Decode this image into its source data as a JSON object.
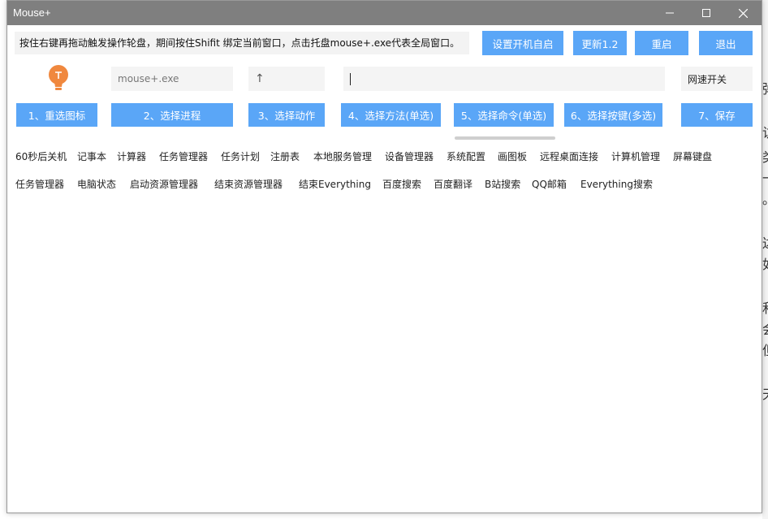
{
  "window": {
    "title": "Mouse+"
  },
  "hint": "按住右键再拖动触发操作轮盘，期间按住Shifit 绑定当前窗口，点击托盘mouse+.exe代表全局窗口。",
  "top_buttons": {
    "autostart": "设置开机自启",
    "update": "更新1.2",
    "restart": "重启",
    "exit": "退出"
  },
  "fields": {
    "process_placeholder": "mouse+.exe",
    "action_value": "↑",
    "command_value": "",
    "speed_toggle": "网速开关"
  },
  "steps": [
    "1、重选图标",
    "2、选择进程",
    "3、选择动作",
    "4、选择方法(单选)",
    "5、选择命令(单选)",
    "6、选择按键(多选)",
    "7、保存"
  ],
  "commands_row1": [
    "60秒后关机",
    "记事本",
    "计算器",
    "任务管理器",
    "任务计划",
    "注册表",
    "本地服务管理",
    "设备管理器",
    "系统配置",
    "画图板",
    "远程桌面连接",
    "计算机管理",
    "屏幕键盘"
  ],
  "commands_row2": [
    "任务管理器",
    "电脑状态",
    "启动资源管理器",
    "结束资源管理器",
    "结束Everything",
    "百度搜索",
    "百度翻译",
    "B站搜索",
    "QQ邮箱",
    "Everything搜索"
  ],
  "colors": {
    "accent": "#5aa6f7",
    "titlebar": "#7f7f7f",
    "bulb": "#f0883e"
  },
  "icons": {
    "bulb": "lightbulb-icon",
    "minimize": "minimize-icon",
    "maximize": "maximize-icon",
    "close": "close-icon"
  }
}
